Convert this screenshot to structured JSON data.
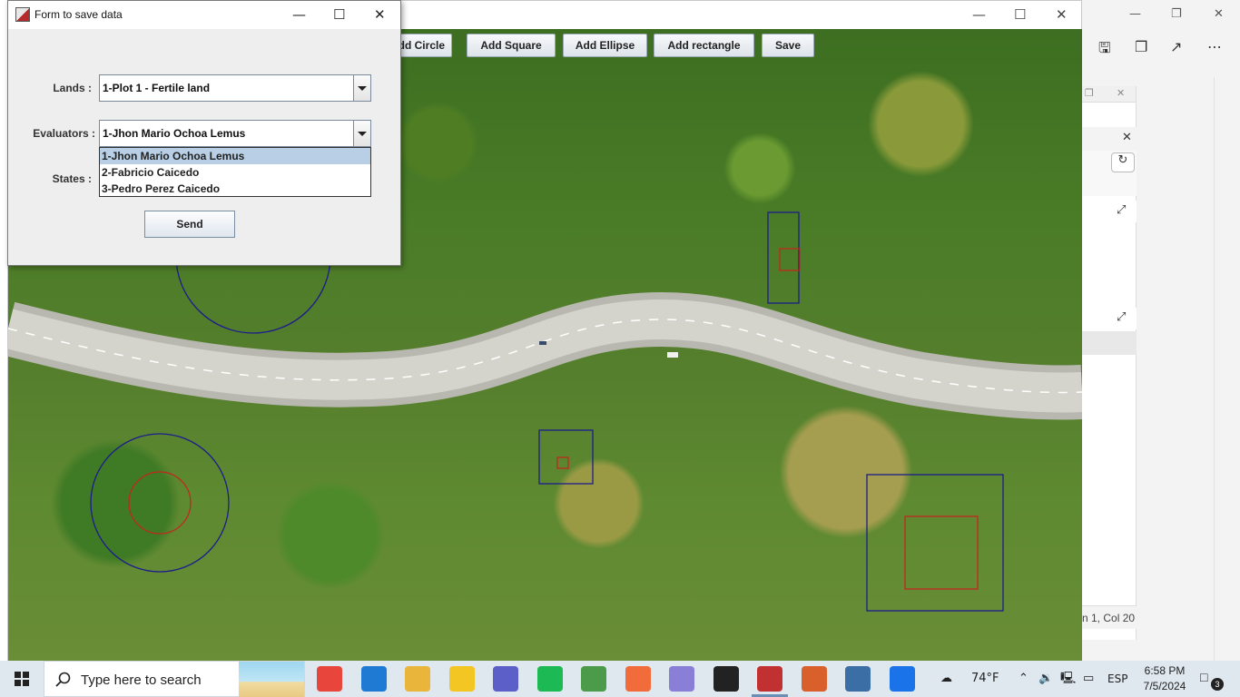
{
  "dialog": {
    "title": "Form to save data",
    "labels": {
      "lands": "Lands :",
      "evaluators": "Evaluators :",
      "states": "States :"
    },
    "lands_value": "1-Plot 1 - Fertile land",
    "evaluators_value": "1-Jhon Mario Ochoa Lemus",
    "dropdown_options": [
      "1-Jhon Mario Ochoa Lemus",
      "2-Fabricio Caicedo",
      "3-Pedro Perez Caicedo"
    ],
    "dropdown_selected_index": 0,
    "send_label": "Send"
  },
  "toolbar": {
    "buttons": [
      "Add Circle",
      "Add Square",
      "Add Ellipse",
      "Add rectangle",
      "Save"
    ]
  },
  "shape_colors": {
    "outer": "#1c1c8c",
    "inner": "#c0281e"
  },
  "background_app": {
    "status_text": "n 1, Col 20"
  },
  "taskbar": {
    "search_placeholder": "Type here to search",
    "weather": "74°F",
    "language": "ESP",
    "time": "6:58 PM",
    "date": "7/5/2024",
    "notification_count": "3",
    "apps": [
      {
        "icon": "chrome-icon",
        "color": "#e8453c"
      },
      {
        "icon": "vscode-icon",
        "color": "#1f7ad4"
      },
      {
        "icon": "file-explorer-icon",
        "color": "#e9b53a"
      },
      {
        "icon": "sticky-notes-icon",
        "color": "#f3c623"
      },
      {
        "icon": "teams-icon",
        "color": "#5b5fc7"
      },
      {
        "icon": "spotify-icon",
        "color": "#1db954"
      },
      {
        "icon": "git-icon",
        "color": "#4b9b4a"
      },
      {
        "icon": "postman-icon",
        "color": "#f26b3a"
      },
      {
        "icon": "magnifier-icon",
        "color": "#8a7fd6"
      },
      {
        "icon": "intellij-icon",
        "color": "#222222"
      },
      {
        "icon": "java-app-icon",
        "color": "#c13131"
      },
      {
        "icon": "dev-tool-icon",
        "color": "#d95f2b"
      },
      {
        "icon": "postgres-icon",
        "color": "#3b6ea5"
      },
      {
        "icon": "help-icon",
        "color": "#1a73e8"
      }
    ]
  }
}
